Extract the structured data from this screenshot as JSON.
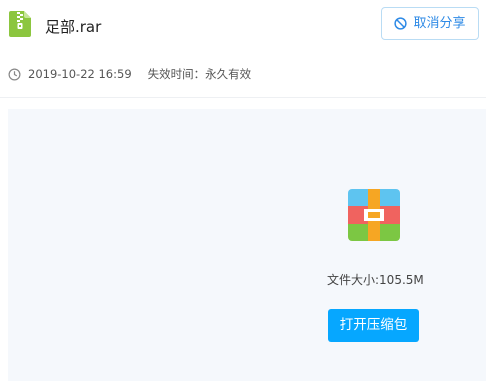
{
  "file": {
    "name": "足部.rar",
    "icon": "zip-file-icon"
  },
  "actions": {
    "cancel_share_label": "取消分享",
    "cancel_share_icon": "ban-icon"
  },
  "meta": {
    "timestamp": "2019-10-22 16:59",
    "expiry": "失效时间：永久有效",
    "icon": "clock-icon"
  },
  "preview": {
    "icon": "archive-icon",
    "file_size": "文件大小:105.5M",
    "open_label": "打开压缩包"
  },
  "colors": {
    "accent": "#06a7ff",
    "link": "#2e8ae6",
    "file_icon_green": "#8cc63f",
    "panel_bg": "#f5f8fc"
  }
}
